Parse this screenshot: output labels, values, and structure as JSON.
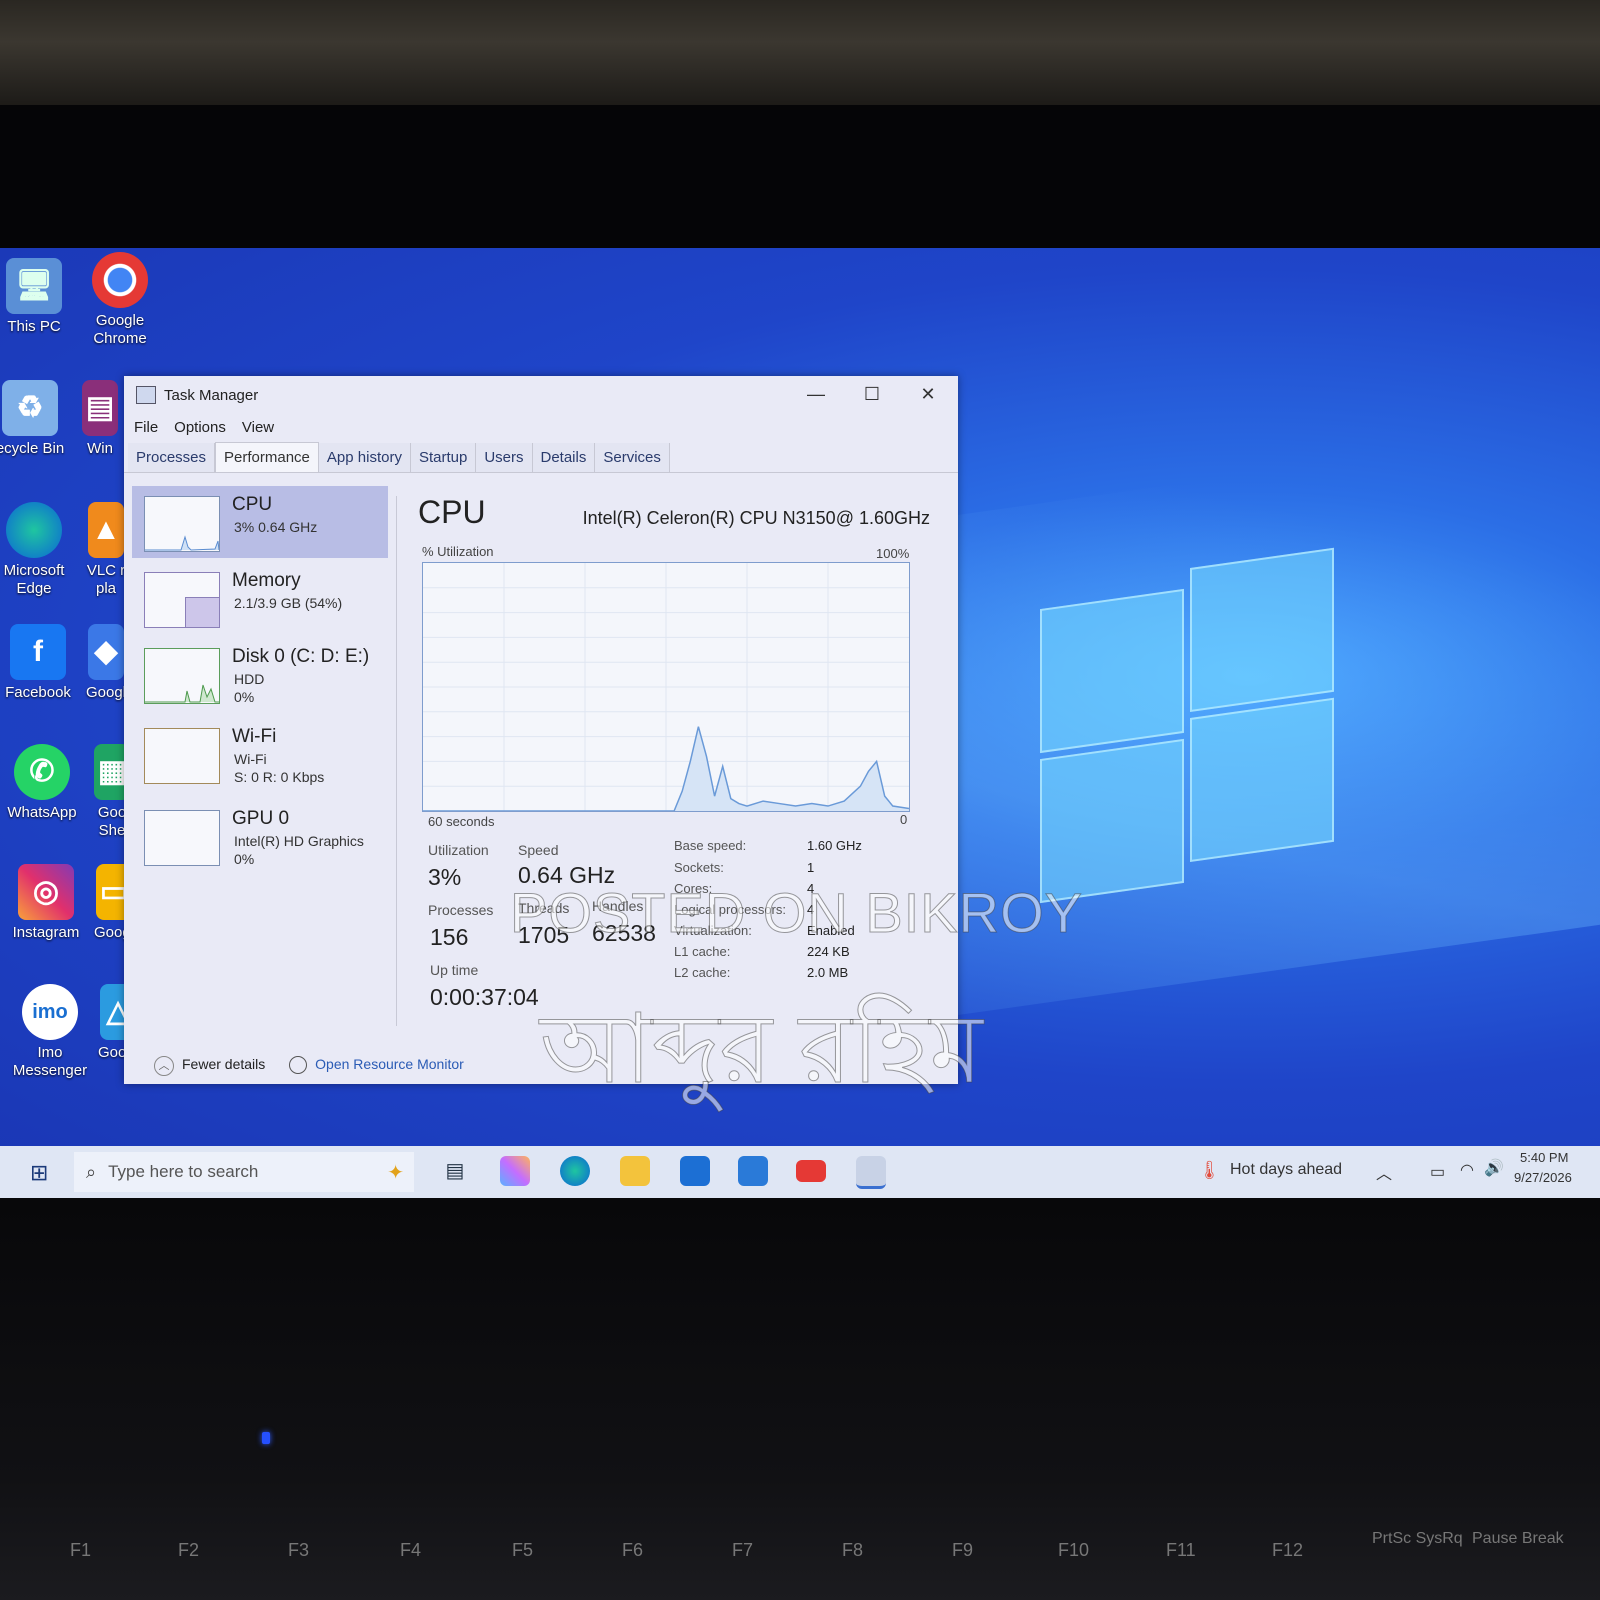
{
  "desktop": {
    "icons": [
      {
        "label": "This PC"
      },
      {
        "label": "Google Chrome"
      },
      {
        "label": "ecycle Bin"
      },
      {
        "label": "Win"
      },
      {
        "label": "Microsoft Edge"
      },
      {
        "label": "VLC r pla"
      },
      {
        "label": "Facebook"
      },
      {
        "label": "Googl"
      },
      {
        "label": "WhatsApp"
      },
      {
        "label": "Goo She"
      },
      {
        "label": "Instagram"
      },
      {
        "label": "Googl"
      },
      {
        "label": "Imo Messenger"
      },
      {
        "label": "Googl"
      }
    ]
  },
  "task_manager": {
    "title": "Task Manager",
    "menu": [
      "File",
      "Options",
      "View"
    ],
    "tabs": [
      "Processes",
      "Performance",
      "App history",
      "Startup",
      "Users",
      "Details",
      "Services"
    ],
    "active_tab": "Performance",
    "sidebar": [
      {
        "name": "CPU",
        "line1": "3% 0.64 GHz",
        "line2": ""
      },
      {
        "name": "Memory",
        "line1": "2.1/3.9 GB (54%)",
        "line2": ""
      },
      {
        "name": "Disk 0 (C: D: E:)",
        "line1": "HDD",
        "line2": "0%"
      },
      {
        "name": "Wi-Fi",
        "line1": "Wi-Fi",
        "line2": "S: 0 R: 0 Kbps"
      },
      {
        "name": "GPU 0",
        "line1": "Intel(R) HD Graphics",
        "line2": "0%"
      }
    ],
    "main": {
      "title": "CPU",
      "cpu_name": "Intel(R) Celeron(R) CPU N3150@ 1.60GHz",
      "graph_label": "% Utilization",
      "graph_max": "100%",
      "graph_span": "60 seconds",
      "graph_min": "0",
      "utilization_label": "Utilization",
      "utilization": "3%",
      "speed_label": "Speed",
      "speed": "0.64 GHz",
      "processes_label": "Processes",
      "processes": "156",
      "threads_label": "Threads",
      "threads": "1705",
      "handles_label": "Handles",
      "handles": "62538",
      "uptime_label": "Up time",
      "uptime": "0:00:37:04",
      "details": [
        {
          "k": "Base speed:",
          "v": "1.60 GHz"
        },
        {
          "k": "Sockets:",
          "v": "1"
        },
        {
          "k": "Cores:",
          "v": "4"
        },
        {
          "k": "Logical processors:",
          "v": "4"
        },
        {
          "k": "Virtualization:",
          "v": "Enabled"
        },
        {
          "k": "L1 cache:",
          "v": "224 KB"
        },
        {
          "k": "L2 cache:",
          "v": "2.0 MB"
        }
      ]
    },
    "footer": {
      "fewer": "Fewer details",
      "monitor": "Open Resource Monitor"
    }
  },
  "chart_data": {
    "type": "area",
    "title": "",
    "xlabel": "60 seconds",
    "ylabel": "% Utilization",
    "ylim": [
      0,
      100
    ],
    "x": [
      0,
      5,
      10,
      15,
      20,
      25,
      30,
      31,
      32,
      33,
      34,
      35,
      36,
      37,
      38,
      39,
      40,
      42,
      44,
      46,
      48,
      50,
      52,
      54,
      55,
      56,
      57,
      58,
      60
    ],
    "values": [
      0,
      0,
      0,
      0,
      0,
      0,
      0,
      0,
      8,
      20,
      34,
      22,
      6,
      18,
      5,
      3,
      2,
      4,
      3,
      2,
      3,
      2,
      4,
      10,
      16,
      20,
      6,
      2,
      1
    ]
  },
  "taskbar": {
    "search_placeholder": "Type here to search",
    "weather": "Hot days ahead",
    "time": "5:40 PM",
    "date": "9/27/2026"
  },
  "watermark": {
    "line1": "POSTED ON BIKROY",
    "line2": "আব্দুর রহিম"
  },
  "keyboard": {
    "keys": [
      "F1",
      "F2",
      "F3",
      "F4",
      "F5",
      "F6",
      "F7",
      "F8",
      "F9",
      "F10",
      "F11",
      "F12",
      "PrtSc SysRq",
      "Pause Break"
    ]
  },
  "colors": {
    "desktop_blue": "#1f45c9",
    "tm_bg": "#e9eaf6",
    "selected": "#b8bde5",
    "graph_line": "#6a9ad8"
  }
}
